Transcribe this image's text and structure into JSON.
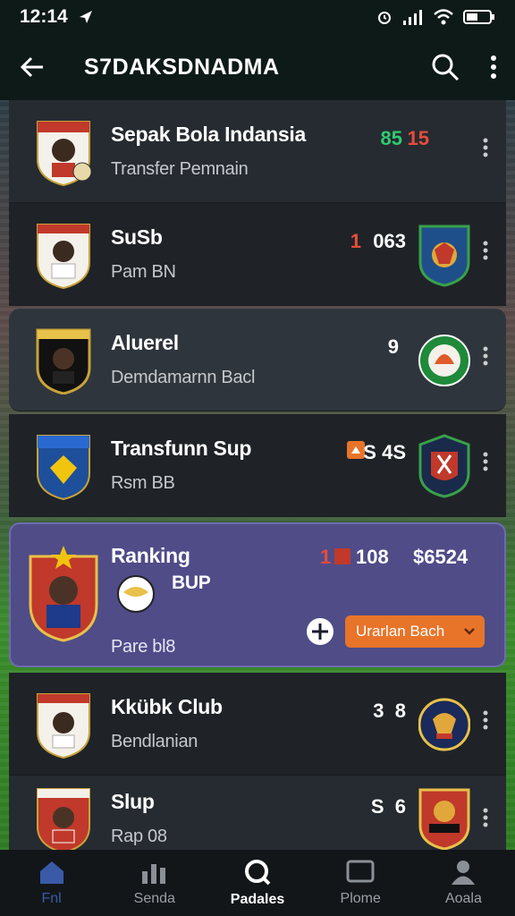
{
  "status": {
    "time": "12:14"
  },
  "appbar": {
    "title": "S7DAKSDNADMA"
  },
  "colors": {
    "accent_orange": "#e8742a",
    "highlight": "#4f4c88"
  },
  "rows": [
    {
      "title": "Sepak Bola Indansia",
      "subtitle": "Transfer Pemnain",
      "score_a": "85",
      "score_b": "15"
    },
    {
      "title": "SuSb",
      "subtitle": "Pam BN",
      "score_marker": "1",
      "score": "063"
    },
    {
      "title": "Aluerel",
      "subtitle": "Demdamarnn Bacl",
      "score": "9"
    },
    {
      "title": "Transfunn Sup",
      "subtitle": "Rsm BB",
      "score": "S 4S"
    },
    {
      "title": "Ranking",
      "sub_label": "BUP",
      "subtitle": "Pare bl8",
      "score_a": "1",
      "score": "108",
      "price": "$6524",
      "dropdown_label": "Urarlan Bach"
    },
    {
      "title": "Kkübk Club",
      "subtitle": "Bendlanian",
      "score": "3  8"
    },
    {
      "title": "Slup",
      "subtitle": "Rap 08",
      "score": "S  6"
    }
  ],
  "tabs": [
    {
      "label": "Fnl",
      "icon": "home-icon"
    },
    {
      "label": "Senda",
      "icon": "stats-icon"
    },
    {
      "label": "Padales",
      "icon": "search-icon"
    },
    {
      "label": "Plome",
      "icon": "screen-icon"
    },
    {
      "label": "Aoala",
      "icon": "profile-icon"
    }
  ]
}
